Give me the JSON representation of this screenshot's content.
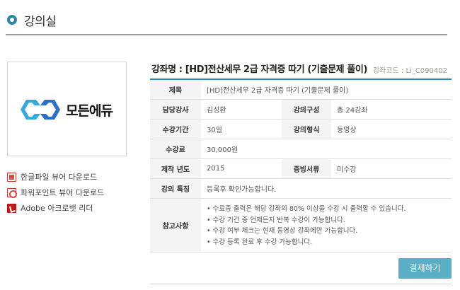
{
  "page": {
    "title": "강의실"
  },
  "logo": {
    "text": "모든에듀",
    "mark_colors": [
      "#3aa7e0",
      "#2b6fc6"
    ]
  },
  "downloads": [
    {
      "label": "한글파일 뷰어 다운로드",
      "icon": "hwp-file-icon"
    },
    {
      "label": "파워포인트 뷰어 다운로드",
      "icon": "ppt-file-icon"
    },
    {
      "label": "Adobe 아크로뱃 리더",
      "icon": "pdf-file-icon"
    }
  ],
  "course": {
    "heading": "강좌명 : [HD]전산세무 2급 자격증 따기 (기출문제 풀이)",
    "code": "강좌코드 : Li_C090402"
  },
  "table": {
    "title_label": "제목",
    "title_value": "[HD]전산세무 2급 자격증 따기 (기출문제 풀이)",
    "instructor_label": "담당강사",
    "instructor_value": "김성환",
    "composition_label": "강의구성",
    "composition_value": "총 24강좌",
    "period_label": "수강기간",
    "period_value": "30일",
    "format_label": "강의형식",
    "format_value": "동영상",
    "fee_label": "수강료",
    "fee_value": "30,000원",
    "year_label": "제작 년도",
    "year_value": "2015",
    "docs_label": "증빙서류",
    "docs_value": "미수강",
    "feature_label": "강의 특징",
    "feature_value": "등록후 확인가능합니다.",
    "notes_label": "참고사항",
    "notes": [
      "수료증 출력은 해당 강좌의 80% 이상을 수강 시 출력할 수 있습니다.",
      "수강 기간 중 언제든지 반복 수강이 가능합니다.",
      "수강 여부 체크는 현재 동영상 강좌에만 가능합니다.",
      "수강 등록 완료 후 수강 가능합니다."
    ]
  },
  "buttons": {
    "pay": "결제하기"
  },
  "colors": {
    "accent": "#2a87a8",
    "button": "#5aafc6"
  }
}
